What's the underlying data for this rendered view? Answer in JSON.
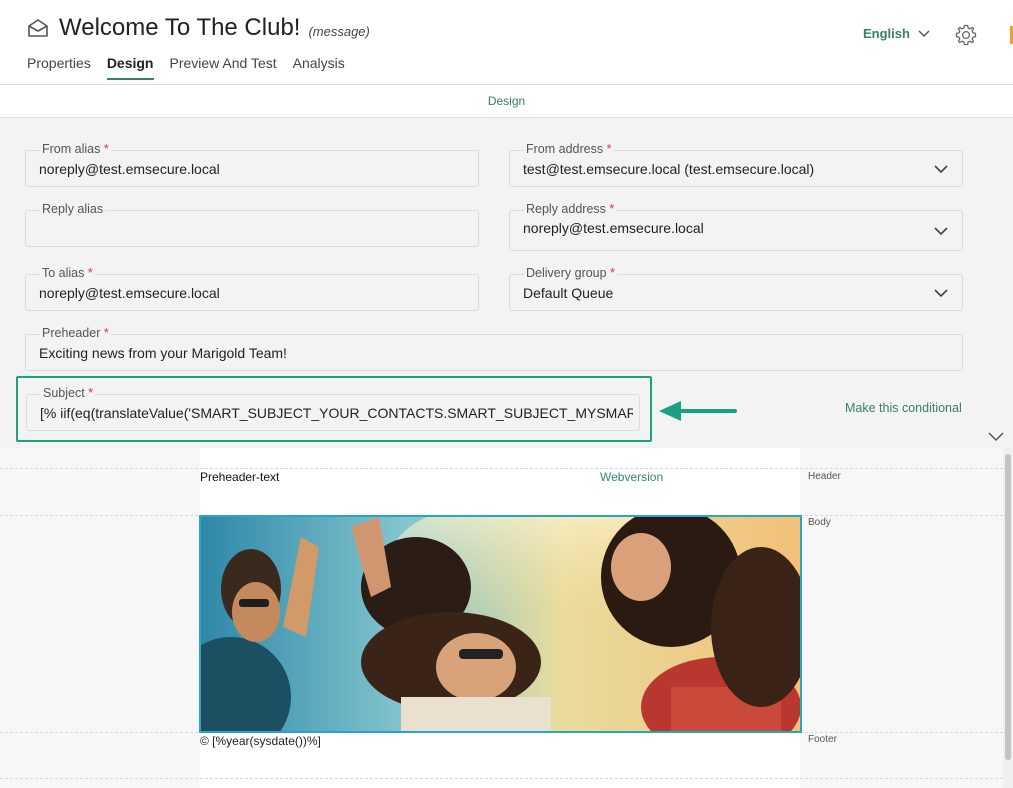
{
  "header": {
    "title": "Welcome To The Club!",
    "type": "(message)",
    "language": "English",
    "tabs": [
      {
        "label": "Properties"
      },
      {
        "label": "Design"
      },
      {
        "label": "Preview And Test"
      },
      {
        "label": "Analysis"
      }
    ]
  },
  "section": {
    "label": "Design"
  },
  "form": {
    "from_alias": {
      "label": "From alias",
      "value": "noreply@test.emsecure.local"
    },
    "from_address": {
      "label": "From address",
      "value": "test@test.emsecure.local (test.emsecure.local)"
    },
    "reply_alias": {
      "label": "Reply alias",
      "value": ""
    },
    "reply_address": {
      "label": "Reply address",
      "value": "noreply@test.emsecure.local"
    },
    "to_alias": {
      "label": "To alias",
      "value": "noreply@test.emsecure.local"
    },
    "delivery_group": {
      "label": "Delivery group",
      "value": "Default Queue"
    },
    "preheader": {
      "label": "Preheader",
      "value": "Exciting news from your Marigold Team!"
    },
    "subject": {
      "label": "Subject",
      "value": "[% iif(eq(translateValue('SMART_SUBJECT_YOUR_CONTACTS.SMART_SUBJECT_MYSMARTSUBJECT"
    },
    "required_mark": "*",
    "make_conditional": "Make this conditional"
  },
  "canvas": {
    "preheader_text": "Preheader-text",
    "webversion": "Webversion",
    "zones": {
      "header": "Header",
      "body": "Body",
      "footer": "Footer"
    },
    "footer_text": "© [%year(sysdate())%]"
  },
  "colors": {
    "accent": "#3a7d6a",
    "highlight": "#1aa083",
    "selection": "#2aa6c4",
    "required": "#dd3333"
  }
}
